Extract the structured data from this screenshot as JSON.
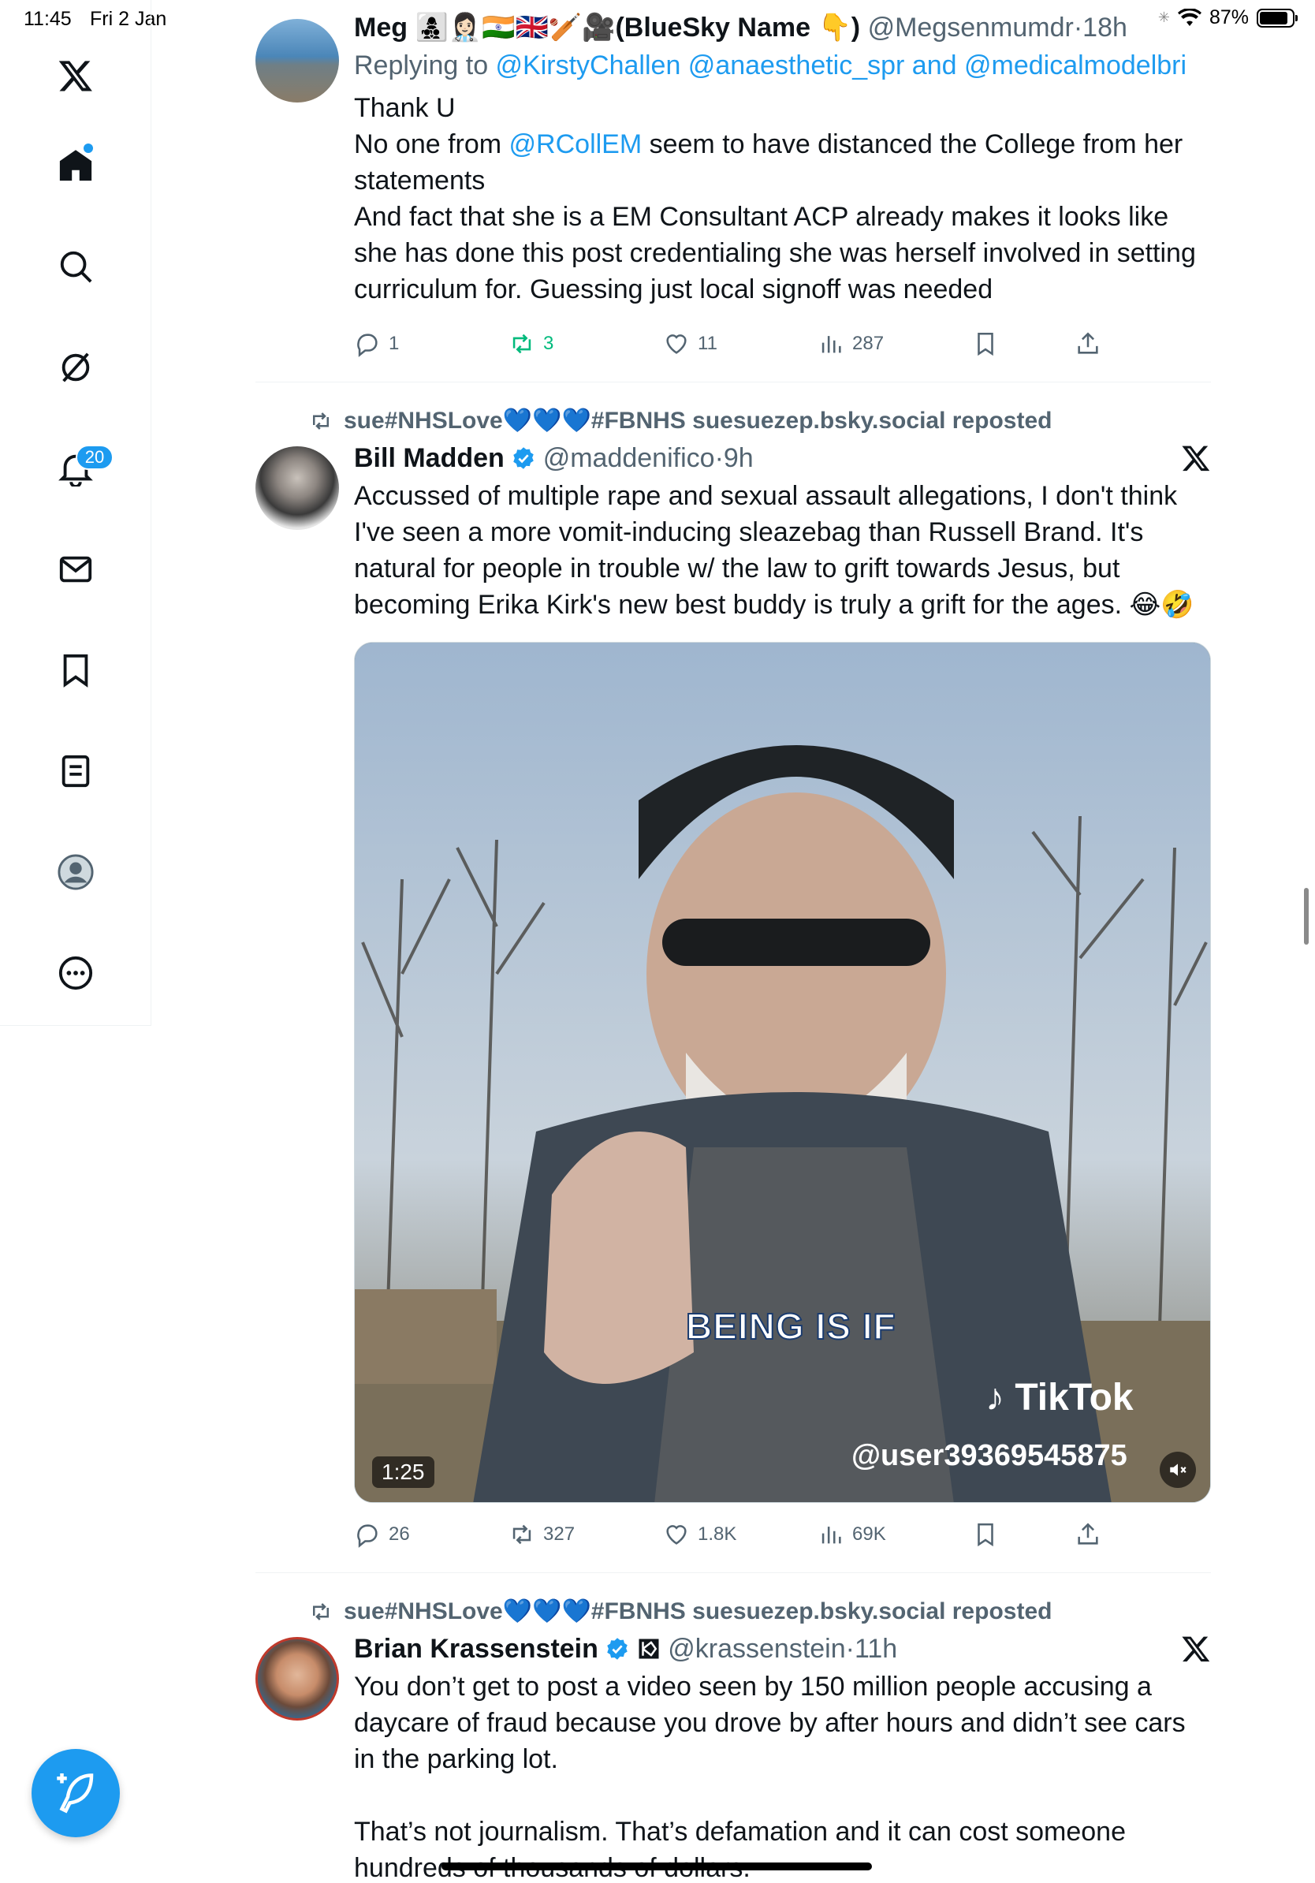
{
  "status_bar": {
    "time": "11:45",
    "date": "Fri 2 Jan",
    "battery": "87%",
    "battery_level": 0.87
  },
  "sidebar": {
    "items": [
      {
        "name": "x-logo",
        "icon": "x-logo-icon"
      },
      {
        "name": "home",
        "icon": "home-icon"
      },
      {
        "name": "explore",
        "icon": "search-icon"
      },
      {
        "name": "grok",
        "icon": "grok-icon"
      },
      {
        "name": "notifications",
        "icon": "bell-icon"
      },
      {
        "name": "messages",
        "icon": "envelope-icon"
      },
      {
        "name": "bookmarks",
        "icon": "bookmark-icon"
      },
      {
        "name": "lists",
        "icon": "list-icon"
      },
      {
        "name": "profile",
        "icon": "avatar-icon"
      },
      {
        "name": "more",
        "icon": "more-icon"
      }
    ],
    "notification_count": "20",
    "compose_icon": "compose-icon"
  },
  "tweets": [
    {
      "name": "Meg 👩‍👧‍👦👩🏻‍⚕️🇮🇳🇬🇧🏏🎥(BlueSky Name 👇)",
      "handle": "@Megsenmumdr",
      "time": "18h",
      "replying_prefix": "Replying to ",
      "replying_to": "@KirstyChallen @anaesthetic_spr and @medicalmodelbri",
      "body": {
        "line1": "Thank U",
        "line2_pre": "No one from ",
        "line2_link": "@RCollEM",
        "line2_post": " seem to have distanced the College from her statements",
        "line3": "And fact that she is a EM Consultant ACP already makes it looks like she has done this post credentialing she was herself involved in setting curriculum for. Guessing just local signoff was needed"
      },
      "stats": {
        "replies": "1",
        "reposts": "3",
        "likes": "11",
        "views": "287"
      }
    },
    {
      "reposted_by": "sue#NHSLove💙💙💙#FBNHS suesuezep.bsky.social reposted",
      "name": "Bill Madden",
      "handle": "@maddenifico",
      "time": "9h",
      "body": "Accussed of multiple rape and sexual assault allegations, I don't think I've seen a more vomit-inducing sleazebag than Russell Brand. It's natural for people in trouble w/ the law to grift towards Jesus, but becoming Erika Kirk's new best buddy is truly a grift for the ages. 😂🤣",
      "media": {
        "duration": "1:25",
        "caption": "BEING IS IF",
        "watermark": "TikTok",
        "watermark_user": "@user39369545875"
      },
      "stats": {
        "replies": "26",
        "reposts": "327",
        "likes": "1.8K",
        "views": "69K"
      }
    },
    {
      "reposted_by": "sue#NHSLove💙💙💙#FBNHS suesuezep.bsky.social reposted",
      "name": "Brian Krassenstein",
      "handle": "@krassenstein",
      "time": "11h",
      "body1": "You don’t get to post a video seen by 150 million people accusing a daycare of fraud because you drove by after hours and didn’t see cars in the parking lot.",
      "body2": "That’s not journalism. That’s defamation and it can cost someone hundreds of thousands of dollars."
    }
  ],
  "colors": {
    "accent": "#1d9bf0",
    "repost_green": "#00ba7c",
    "secondary_text": "#536471"
  }
}
